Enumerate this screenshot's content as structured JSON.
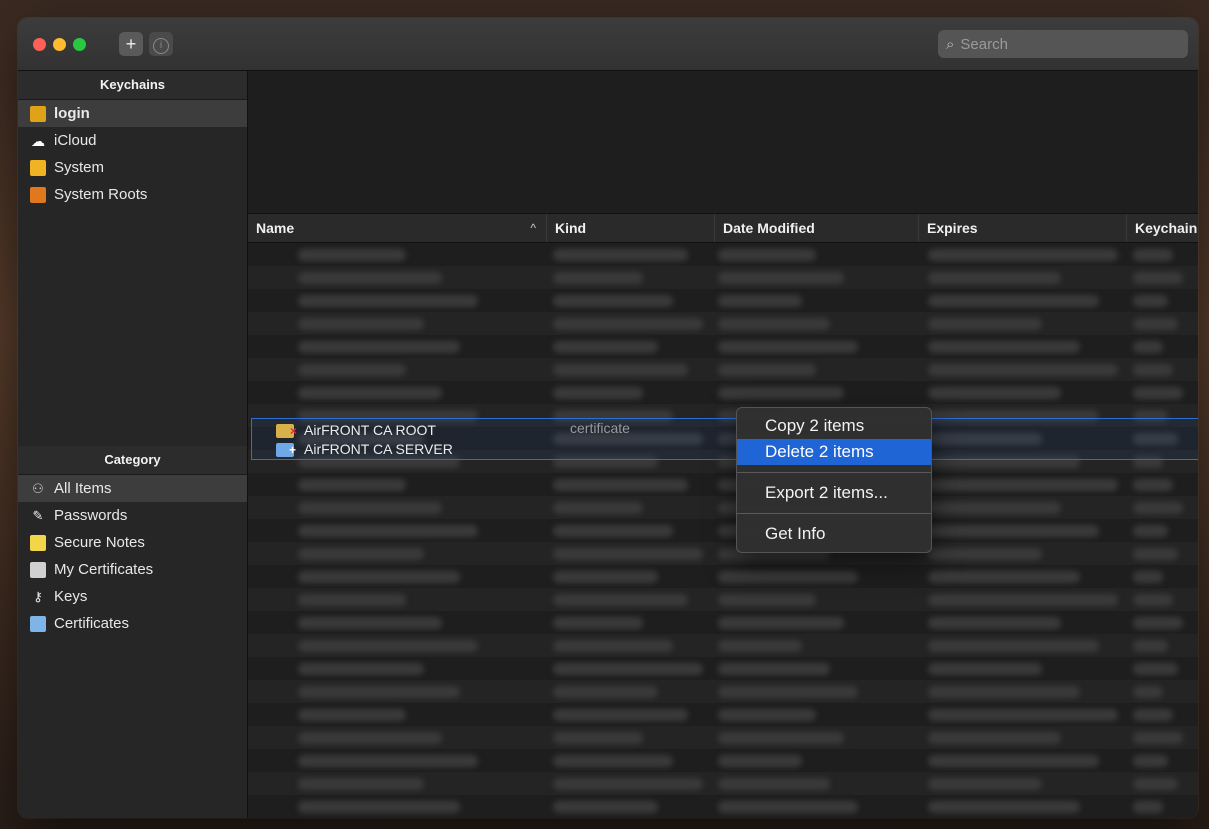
{
  "toolbar": {
    "add_label": "+",
    "info_label": "i",
    "search_placeholder": "Search"
  },
  "sidebar": {
    "keychains_title": "Keychains",
    "keychains": [
      {
        "label": "login",
        "icon": "lock-open-icon",
        "selected": true
      },
      {
        "label": "iCloud",
        "icon": "cloud-icon",
        "selected": false
      },
      {
        "label": "System",
        "icon": "lock-icon",
        "selected": false
      },
      {
        "label": "System Roots",
        "icon": "cabinet-icon",
        "selected": false
      }
    ],
    "category_title": "Category",
    "categories": [
      {
        "label": "All Items",
        "icon": "all-items-icon",
        "selected": true
      },
      {
        "label": "Passwords",
        "icon": "password-icon",
        "selected": false
      },
      {
        "label": "Secure Notes",
        "icon": "note-icon",
        "selected": false
      },
      {
        "label": "My Certificates",
        "icon": "my-certificate-icon",
        "selected": false
      },
      {
        "label": "Keys",
        "icon": "key-icon",
        "selected": false
      },
      {
        "label": "Certificates",
        "icon": "certificate-icon",
        "selected": false
      }
    ]
  },
  "table": {
    "columns": [
      "Name",
      "Kind",
      "Date Modified",
      "Expires",
      "Keychain"
    ],
    "sort_indicator": "^",
    "selected_rows": [
      {
        "name": "AirFRONT CA ROOT",
        "kind": "certificate",
        "icon": "certificate-invalid-icon"
      },
      {
        "name": "AirFRONT CA SERVER",
        "kind": "",
        "icon": "certificate-trusted-icon"
      }
    ]
  },
  "context_menu": {
    "items": [
      {
        "label": "Copy 2 items",
        "active": false
      },
      {
        "label": "Delete 2 items",
        "active": true
      },
      {
        "label": "Export 2 items...",
        "active": false
      },
      {
        "label": "Get Info",
        "active": false
      }
    ]
  },
  "colors": {
    "accent": "#1f65d6",
    "selection_border": "#2b6fd6"
  }
}
